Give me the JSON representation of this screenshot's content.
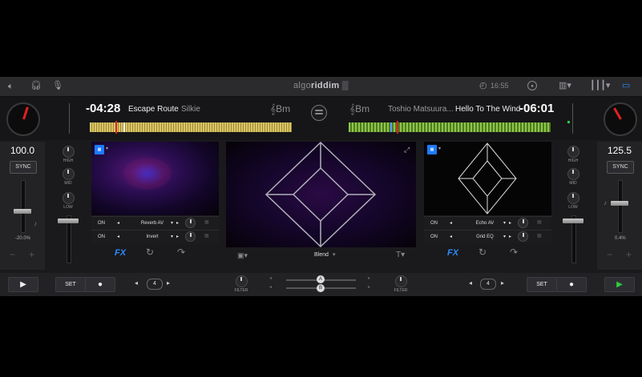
{
  "topbar": {
    "logo_prefix": "algo",
    "logo_main": "riddim",
    "clock": "16:55"
  },
  "deck_left": {
    "time": "-04:28",
    "track_title": "Escape Route",
    "artist": "Silkie",
    "key": "Bm",
    "bpm": "100.0",
    "sync_label": "SYNC",
    "pitch": "-20.0%",
    "fx": [
      {
        "on": "ON",
        "name": "Reverb AV"
      },
      {
        "on": "ON",
        "name": "Invert"
      }
    ],
    "fx_label": "FX",
    "set_label": "SET",
    "loop_value": "4"
  },
  "deck_right": {
    "time": "-06:01",
    "track_title": "Hello To The Wind",
    "artist": "Toshio Matsuura...",
    "key": "Bm",
    "bpm": "125.5",
    "sync_label": "SYNC",
    "pitch": "0.4%",
    "fx": [
      {
        "on": "ON",
        "name": "Echo AV"
      },
      {
        "on": "ON",
        "name": "Grid EQ"
      }
    ],
    "fx_label": "FX",
    "set_label": "SET",
    "loop_value": "4"
  },
  "eq_labels": {
    "high": "HIGH",
    "mid": "MID",
    "low": "LOW"
  },
  "video": {
    "blend_label": "Blend"
  },
  "mixer": {
    "filter_label": "FILTER",
    "a_label": "A",
    "b_label": "B"
  },
  "colors": {
    "accent_blue": "#1e7bff",
    "play_green": "#2ecc40",
    "needle_red": "#e02020"
  }
}
